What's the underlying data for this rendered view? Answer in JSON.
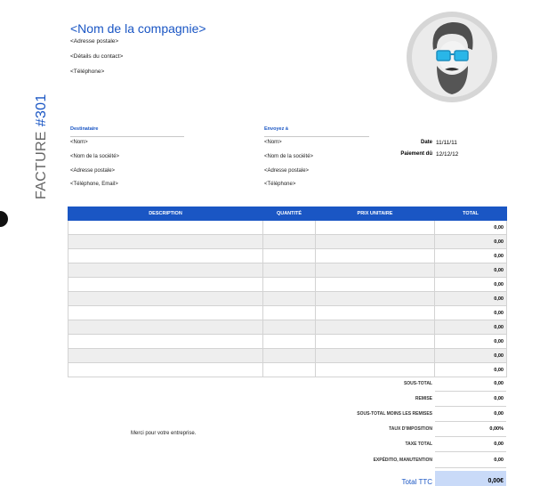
{
  "doc": {
    "title_word": "FACTURE",
    "title_number": "#301"
  },
  "company": {
    "name": "<Nom de la compagnie>",
    "lines": [
      "<Adresse postale>",
      "<Détails du contact>",
      "<Téléphone>"
    ]
  },
  "recipient": {
    "heading": "Destinataire",
    "lines": [
      "<Nom>",
      "<Nom de la société>",
      "<Adresse postale>",
      "<Téléphone, Email>"
    ]
  },
  "ship_to": {
    "heading": "Envoyez à",
    "lines": [
      "<Nom>",
      "<Nom de la société>",
      "<Adresse postale>",
      "<Téléphone>"
    ]
  },
  "dates": {
    "date_label": "Date",
    "date_value": "11/11/11",
    "due_label": "Paiement dû",
    "due_value": "12/12/12"
  },
  "table": {
    "headers": [
      "DESCRIPTION",
      "QUANTITÉ",
      "PRIX UNITAIRE",
      "TOTAL"
    ],
    "row_totals": [
      "0,00",
      "0,00",
      "0,00",
      "0,00",
      "0,00",
      "0,00",
      "0,00",
      "0,00",
      "0,00",
      "0,00",
      "0,00"
    ]
  },
  "summary": [
    {
      "label": "SOUS-TOTAL",
      "value": "0,00"
    },
    {
      "label": "REMISE",
      "value": "0,00"
    },
    {
      "label": "SOUS-TOTAL MOINS LES REMISES",
      "value": "0,00"
    },
    {
      "label": "TAUX D'IMPOSITION",
      "value": "0,00%"
    },
    {
      "label": "TAXE TOTAL",
      "value": "0,00"
    },
    {
      "label": "EXPÉDITIO, MANUTENTION",
      "value": "0,00"
    }
  ],
  "thanks": "Merci pour votre entreprise.",
  "total": {
    "label": "Total TTC",
    "value": "0,00€"
  },
  "colors": {
    "accent": "#1a56c4",
    "total_highlight": "#c9daf8"
  }
}
